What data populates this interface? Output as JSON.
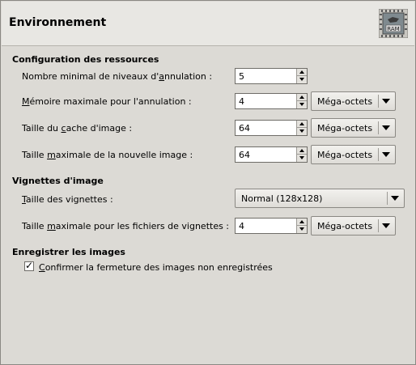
{
  "header": {
    "title": "Environnement",
    "icon": "ram-icon",
    "icon_text": "RAM"
  },
  "resources": {
    "title": "Configuration des ressources",
    "undo_levels": {
      "label_pre": "Nombre minimal de niveaux d'",
      "label_u": "a",
      "label_post": "nnulation :",
      "value": "5"
    },
    "undo_memory": {
      "label_pre": "",
      "label_u": "M",
      "label_post": "émoire maximale pour l'annulation :",
      "value": "4",
      "unit": "Méga-octets"
    },
    "tile_cache": {
      "label_pre": "Taille du ",
      "label_u": "c",
      "label_post": "ache d'image :",
      "value": "64",
      "unit": "Méga-octets"
    },
    "max_new_image": {
      "label_pre": "Taille ",
      "label_u": "m",
      "label_post": "aximale de la nouvelle image :",
      "value": "64",
      "unit": "Méga-octets"
    }
  },
  "thumbnails": {
    "title": "Vignettes d'image",
    "size": {
      "label_pre": "",
      "label_u": "T",
      "label_post": "aille des vignettes :",
      "value": "Normal (128x128)"
    },
    "max_filesize": {
      "label_pre": "Taille ",
      "label_u": "m",
      "label_post": "aximale pour les fichiers de vignettes :",
      "value": "4",
      "unit": "Méga-octets"
    }
  },
  "saving": {
    "title": "Enregistrer les images",
    "confirm_close": {
      "label_pre": "",
      "label_u": "C",
      "label_post": "onfirmer la fermeture des images non enregistrées",
      "checked": true,
      "mark": "✓"
    }
  }
}
